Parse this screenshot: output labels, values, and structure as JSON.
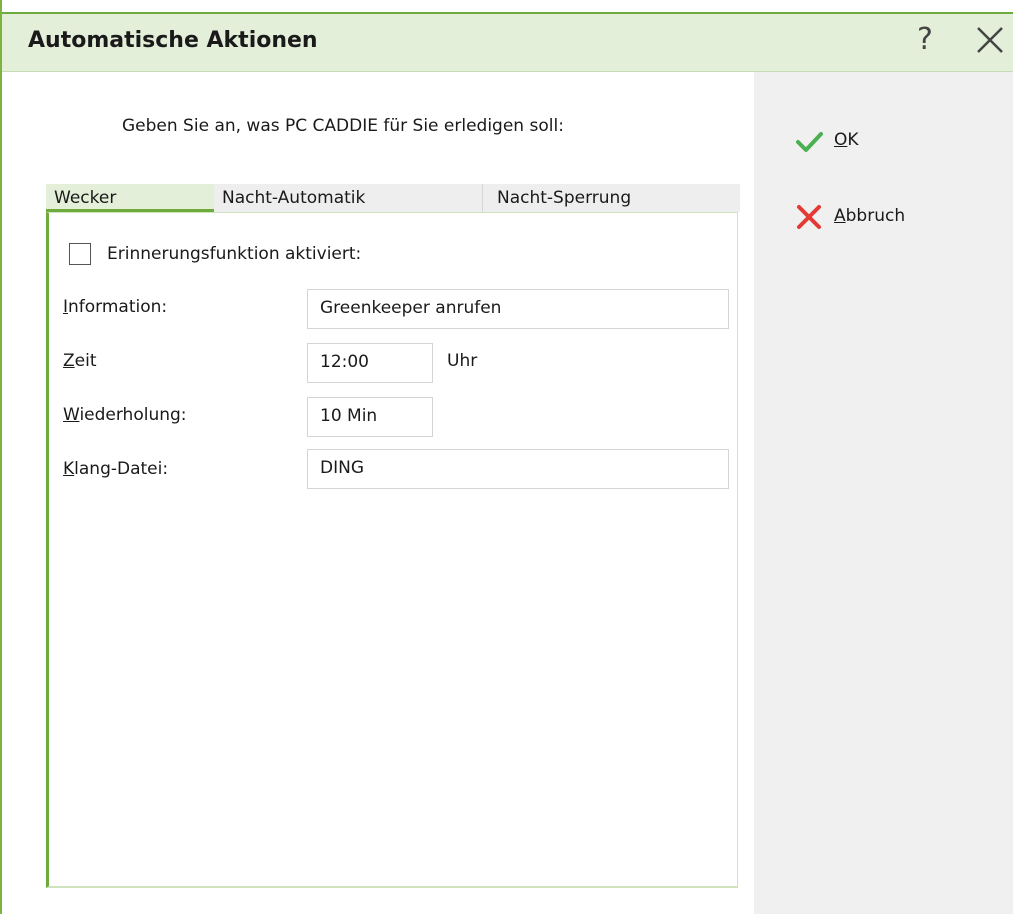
{
  "window": {
    "title": "Automatische Aktionen"
  },
  "titlebar": {
    "help_label": "?"
  },
  "prompt": "Geben Sie an, was PC CADDIE für Sie erledigen soll:",
  "tabs": [
    {
      "label": "Wecker",
      "active": true
    },
    {
      "label": "Nacht-Automatik",
      "active": false
    },
    {
      "label": "Nacht-Sperrung",
      "active": false
    }
  ],
  "wecker": {
    "reminder_checkbox": {
      "label": "Erinnerungsfunktion aktiviert:",
      "checked": false
    },
    "information": {
      "label_first": "I",
      "label_rest": "nformation:",
      "value": "Greenkeeper anrufen"
    },
    "zeit": {
      "label_first": "Z",
      "label_rest": "eit",
      "value": "12:00",
      "unit": "Uhr"
    },
    "wiederholung": {
      "label_first": "W",
      "label_rest": "iederholung:",
      "value": "10 Min"
    },
    "klang": {
      "label_first": "K",
      "label_rest": "lang-Datei:",
      "value": "DING"
    }
  },
  "actions": {
    "ok": {
      "label_first": "O",
      "label_rest": "K",
      "icon": "checkmark-icon",
      "color": "#4caf50"
    },
    "cancel": {
      "label_first": "A",
      "label_rest": "bbruch",
      "icon": "cross-icon",
      "color": "#e53935"
    }
  },
  "colors": {
    "accent": "#6eab3c",
    "titlebar_bg": "#e3efd9",
    "side_panel_bg": "#f0f0f0"
  }
}
